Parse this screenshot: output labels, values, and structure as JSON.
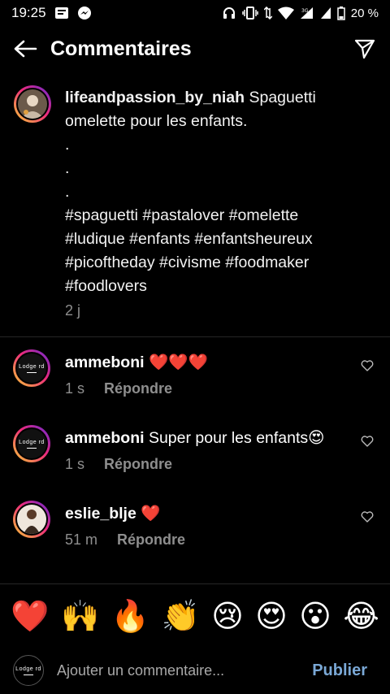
{
  "status_bar": {
    "time": "19:25",
    "battery": "20 %",
    "network": "3G"
  },
  "header": {
    "title": "Commentaires"
  },
  "caption": {
    "username": "lifeandpassion_by_niah",
    "text_line1": "Spaguetti",
    "text_line2": "omelette pour les enfants.",
    "dots": [
      ".",
      ".",
      "."
    ],
    "tags_line1": "#spaguetti #pastalover #omelette",
    "tags_line2": "#ludique #enfants #enfantsheureux",
    "tags_line3": "#picoftheday #civisme #foodmaker",
    "tags_line4": "#foodlovers",
    "time": "2 j"
  },
  "comments": [
    {
      "username": "ammeboni",
      "text": "❤️❤️❤️",
      "time": "1 s",
      "reply": "Répondre",
      "avatar_logo": "Lodge rd"
    },
    {
      "username": "ammeboni",
      "text": "Super pour les enfants😍",
      "time": "1 s",
      "reply": "Répondre",
      "avatar_logo": "Lodge rd"
    },
    {
      "username": "eslie_blje",
      "text": "❤️",
      "time": "51 m",
      "reply": "Répondre"
    }
  ],
  "emoji_bar": [
    "❤️",
    "🙌",
    "🔥",
    "👏",
    "😢",
    "😍",
    "😮",
    "😂"
  ],
  "input": {
    "placeholder": "Ajouter un commentaire...",
    "publish": "Publier",
    "avatar_logo": "Lodge rd"
  },
  "colors": {
    "background": "#000000",
    "secondary_text": "#8e8e8e",
    "publish": "#7aa8d6",
    "heart": "#ed4956"
  }
}
